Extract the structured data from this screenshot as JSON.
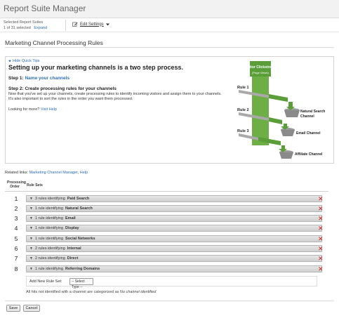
{
  "app": {
    "title": "Report Suite Manager"
  },
  "suite_bar": {
    "label": "Selected Report Suites",
    "count": "1 of 31 selected",
    "expand": "Expand",
    "edit_settings": "Edit Settings",
    "edit_icon": "pencil-icon",
    "dropdown_icon": "caret-down-icon"
  },
  "page": {
    "title": "Marketing Channel Processing Rules"
  },
  "tips": {
    "hide": "Hide Quick Tips",
    "heading": "Setting up your marketing channels is a two step process.",
    "step1_prefix": "Step 1:",
    "step1_link": "Name your channels",
    "step2": "Step 2: Create processing rules for your channels",
    "step2_text": "Now that you've set up your channels, create processing rules to identify incoming visitors and assign them to your channels. It's also important to sort the rules in the order you want them processed.",
    "looking_prefix": "Looking for more?",
    "looking_link": "Visit Help",
    "diagram": {
      "source_title": "Visitor Clickstream",
      "source_sub": "(Page Views)",
      "rule1": "Rule 1",
      "rule2": "Rule 2",
      "rule3": "Rule 3",
      "channel1a": "Natural Search",
      "channel1b": "Channel",
      "channel2": "Email Channel",
      "channel3": "Affiliate Channel"
    }
  },
  "related": {
    "prefix": "Related links:",
    "link1": "Marketing Channel Manager",
    "sep": ",",
    "link2": "Help"
  },
  "table": {
    "col_order": "Processing Order",
    "col_sets": "Rule Sets",
    "rows": [
      {
        "num": "1",
        "prefix": "3 rules identifying",
        "channel": "Paid Search"
      },
      {
        "num": "2",
        "prefix": "1 rule identifying",
        "channel": "Natural Search"
      },
      {
        "num": "3",
        "prefix": "1 rule identifying",
        "channel": "Email"
      },
      {
        "num": "4",
        "prefix": "1 rule identifying",
        "channel": "Display"
      },
      {
        "num": "5",
        "prefix": "1 rule identifying",
        "channel": "Social Networks"
      },
      {
        "num": "6",
        "prefix": "2 rules identifying",
        "channel": "Internal"
      },
      {
        "num": "7",
        "prefix": "2 rules identifying",
        "channel": "Direct"
      },
      {
        "num": "8",
        "prefix": "1 rule identifying",
        "channel": "Referring Domains"
      }
    ],
    "delete_glyph": "✕"
  },
  "new_rule_set": {
    "label": "Add New Rule Set:",
    "select_value": "-- Select Type --"
  },
  "note": {
    "prefix": "All hits not identified with a channel are categorized as",
    "emph": "No channel identified"
  },
  "buttons": {
    "save": "Save",
    "cancel": "Cancel"
  },
  "colors": {
    "link": "#2a6ebb",
    "diagram_green": "#5a9e3a",
    "delete_red": "#cc2222"
  }
}
